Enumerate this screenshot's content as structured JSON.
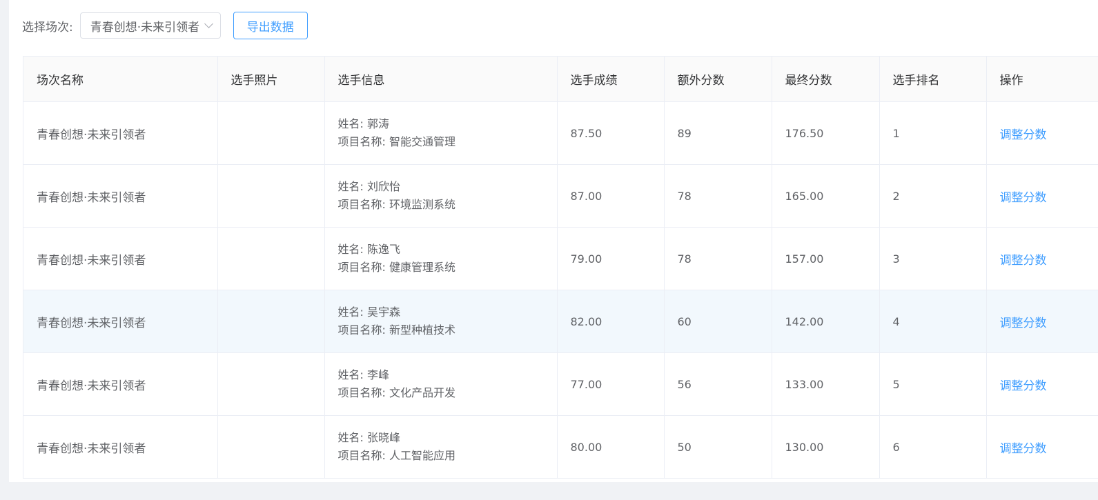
{
  "toolbar": {
    "label": "选择场次:",
    "select_value": "青春创想·未来引领者",
    "export_label": "导出数据"
  },
  "table": {
    "headers": [
      "场次名称",
      "选手照片",
      "选手信息",
      "选手成绩",
      "额外分数",
      "最终分数",
      "选手排名",
      "操作"
    ],
    "rows": [
      {
        "session": "青春创想·未来引领者",
        "name": "姓名: 郭涛",
        "project": "项目名称: 智能交通管理",
        "score": "87.50",
        "extra": "89",
        "final": "176.50",
        "rank": "1",
        "action": "调整分数"
      },
      {
        "session": "青春创想·未来引领者",
        "name": "姓名: 刘欣怡",
        "project": "项目名称: 环境监测系统",
        "score": "87.00",
        "extra": "78",
        "final": "165.00",
        "rank": "2",
        "action": "调整分数"
      },
      {
        "session": "青春创想·未来引领者",
        "name": "姓名: 陈逸飞",
        "project": "项目名称: 健康管理系统",
        "score": "79.00",
        "extra": "78",
        "final": "157.00",
        "rank": "3",
        "action": "调整分数"
      },
      {
        "session": "青春创想·未来引领者",
        "name": "姓名: 吴宇森",
        "project": "项目名称: 新型种植技术",
        "score": "82.00",
        "extra": "60",
        "final": "142.00",
        "rank": "4",
        "action": "调整分数"
      },
      {
        "session": "青春创想·未来引领者",
        "name": "姓名: 李峰",
        "project": "项目名称: 文化产品开发",
        "score": "77.00",
        "extra": "56",
        "final": "133.00",
        "rank": "5",
        "action": "调整分数"
      },
      {
        "session": "青春创想·未来引领者",
        "name": "姓名: 张晓峰",
        "project": "项目名称: 人工智能应用",
        "score": "80.00",
        "extra": "50",
        "final": "130.00",
        "rank": "6",
        "action": "调整分数"
      }
    ]
  },
  "colors": {
    "accent": "#409eff",
    "row_hover": "#f2f8fd"
  }
}
